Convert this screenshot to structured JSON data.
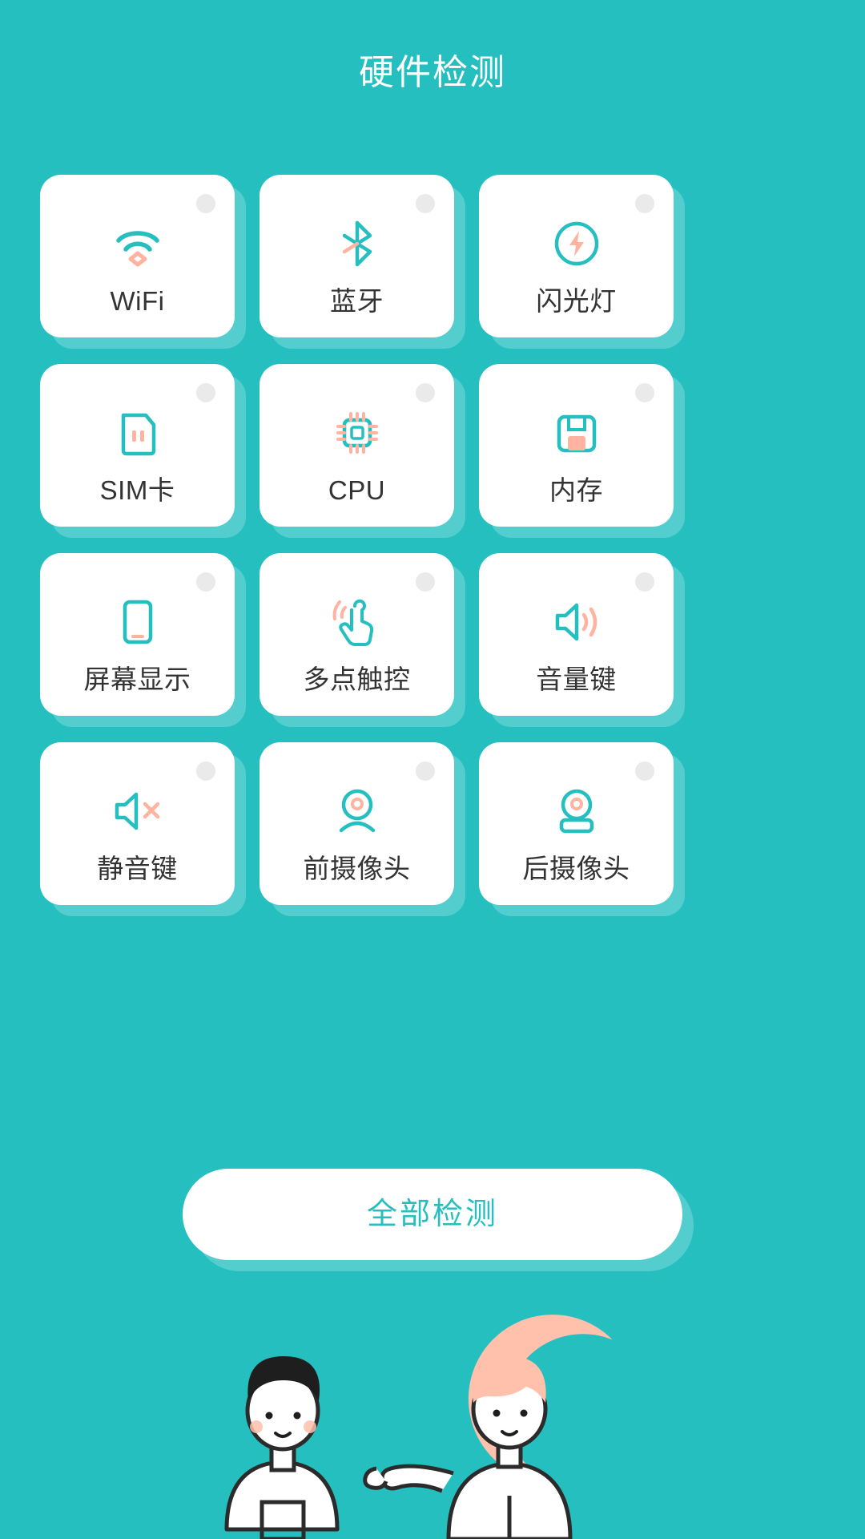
{
  "theme": {
    "background": "#25BFC0",
    "card_background": "#FFFFFF",
    "icon_primary": "#25BFC0",
    "icon_accent": "#FFB3A0",
    "label_color": "#333333",
    "status_dot_color": "#EAEAEA",
    "button_text_color": "#25BFC0"
  },
  "header": {
    "title": "硬件检测"
  },
  "grid": {
    "columns": 3,
    "items": [
      {
        "id": "wifi",
        "label": "WiFi",
        "icon": "wifi-icon",
        "status": "idle"
      },
      {
        "id": "bluetooth",
        "label": "蓝牙",
        "icon": "bluetooth-icon",
        "status": "idle"
      },
      {
        "id": "flashlight",
        "label": "闪光灯",
        "icon": "flashlight-icon",
        "status": "idle"
      },
      {
        "id": "sim",
        "label": "SIM卡",
        "icon": "sim-card-icon",
        "status": "idle"
      },
      {
        "id": "cpu",
        "label": "CPU",
        "icon": "cpu-icon",
        "status": "idle"
      },
      {
        "id": "memory",
        "label": "内存",
        "icon": "memory-icon",
        "status": "idle"
      },
      {
        "id": "screen",
        "label": "屏幕显示",
        "icon": "screen-icon",
        "status": "idle"
      },
      {
        "id": "multitouch",
        "label": "多点触控",
        "icon": "touch-icon",
        "status": "idle"
      },
      {
        "id": "volume",
        "label": "音量键",
        "icon": "volume-up-icon",
        "status": "idle"
      },
      {
        "id": "mute",
        "label": "静音键",
        "icon": "volume-mute-icon",
        "status": "idle"
      },
      {
        "id": "front-cam",
        "label": "前摄像头",
        "icon": "front-camera-icon",
        "status": "idle"
      },
      {
        "id": "rear-cam",
        "label": "后摄像头",
        "icon": "rear-camera-icon",
        "status": "idle"
      }
    ]
  },
  "actions": {
    "detect_all_label": "全部检测"
  },
  "illustration": {
    "description": "two cartoon characters in front of a peach crescent moon"
  }
}
